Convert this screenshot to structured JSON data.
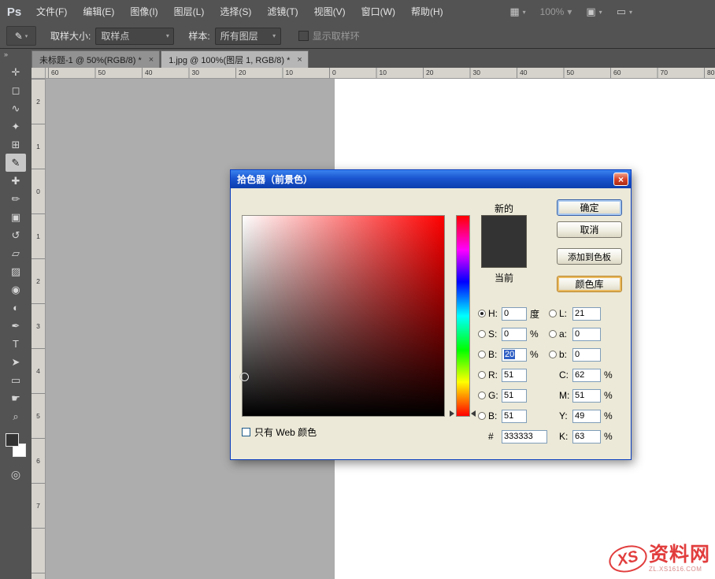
{
  "menu_bar": {
    "logo": "Ps",
    "items": [
      "文件(F)",
      "编辑(E)",
      "图像(I)",
      "图层(L)",
      "选择(S)",
      "滤镜(T)",
      "视图(V)",
      "窗口(W)",
      "帮助(H)"
    ],
    "zoom_value": "100%",
    "icons": {
      "arrange": "▦",
      "extras": "▣",
      "screen": "▭",
      "chevron": "▾"
    }
  },
  "options_bar": {
    "tool_icon": "✎",
    "chevron": "▾",
    "sample_size_label": "取样大小:",
    "sample_size_value": "取样点",
    "sample_label": "样本:",
    "sample_value": "所有图层",
    "show_ring_label": "显示取样环"
  },
  "tab_bar": {
    "tabs": [
      {
        "label": "未标题-1 @ 50%(RGB/8) *",
        "close": "×"
      },
      {
        "label": "1.jpg @ 100%(图层 1, RGB/8) *",
        "close": "×",
        "active": true
      }
    ]
  },
  "rulers": {
    "horizontal": [
      "60",
      "50",
      "40",
      "30",
      "20",
      "10",
      "0",
      "10",
      "20",
      "30",
      "40",
      "50",
      "60",
      "70",
      "80"
    ],
    "vertical": [
      "2",
      "1",
      "0",
      "1",
      "2",
      "3",
      "4",
      "5",
      "6",
      "7"
    ]
  },
  "toolbar": {
    "collapse_icon": "»",
    "quick_mask_icon": "◎",
    "foreground_color": "#333333",
    "background_color": "#ffffff",
    "tools": [
      {
        "name": "move-tool",
        "glyph": "✛"
      },
      {
        "name": "marquee-tool",
        "glyph": "◻"
      },
      {
        "name": "lasso-tool",
        "glyph": "∿"
      },
      {
        "name": "quick-selection-tool",
        "glyph": "✦"
      },
      {
        "name": "crop-tool",
        "glyph": "⊞"
      },
      {
        "name": "eyedropper-tool",
        "glyph": "✎",
        "active": true
      },
      {
        "name": "healing-brush-tool",
        "glyph": "✚"
      },
      {
        "name": "brush-tool",
        "glyph": "✏"
      },
      {
        "name": "clone-stamp-tool",
        "glyph": "▣"
      },
      {
        "name": "history-brush-tool",
        "glyph": "↺"
      },
      {
        "name": "eraser-tool",
        "glyph": "▱"
      },
      {
        "name": "gradient-tool",
        "glyph": "▨"
      },
      {
        "name": "blur-tool",
        "glyph": "◉"
      },
      {
        "name": "dodge-tool",
        "glyph": "◐"
      },
      {
        "name": "pen-tool",
        "glyph": "✒"
      },
      {
        "name": "type-tool",
        "glyph": "T"
      },
      {
        "name": "path-selection-tool",
        "glyph": "➤"
      },
      {
        "name": "shape-tool",
        "glyph": "▭"
      },
      {
        "name": "hand-tool",
        "glyph": "☛"
      },
      {
        "name": "zoom-tool",
        "glyph": "⌕"
      }
    ]
  },
  "dialog": {
    "title": "拾色器（前景色）",
    "close_icon": "×",
    "new_label": "新的",
    "current_label": "当前",
    "new_color": "#333333",
    "current_color": "#333333",
    "buttons": {
      "ok": "确定",
      "cancel": "取消",
      "add_to_swatches": "添加到色板",
      "color_libraries": "颜色库"
    },
    "fields": {
      "h": {
        "label": "H:",
        "value": "0",
        "unit": "度"
      },
      "s": {
        "label": "S:",
        "value": "0",
        "unit": "%"
      },
      "b": {
        "label": "B:",
        "value": "20",
        "unit": "%"
      },
      "r": {
        "label": "R:",
        "value": "51"
      },
      "g": {
        "label": "G:",
        "value": "51"
      },
      "b2": {
        "label": "B:",
        "value": "51"
      },
      "hex": {
        "label": "#",
        "value": "333333"
      },
      "l": {
        "label": "L:",
        "value": "21"
      },
      "a": {
        "label": "a:",
        "value": "0"
      },
      "b3": {
        "label": "b:",
        "value": "0"
      },
      "c": {
        "label": "C:",
        "value": "62",
        "unit": "%"
      },
      "m": {
        "label": "M:",
        "value": "51",
        "unit": "%"
      },
      "y": {
        "label": "Y:",
        "value": "49",
        "unit": "%"
      },
      "k": {
        "label": "K:",
        "value": "63",
        "unit": "%"
      }
    },
    "web_only_label": "只有 Web 颜色"
  },
  "watermark": {
    "logo": "XS",
    "text": "资料网",
    "sub": "ZL.XS1616.COM"
  }
}
